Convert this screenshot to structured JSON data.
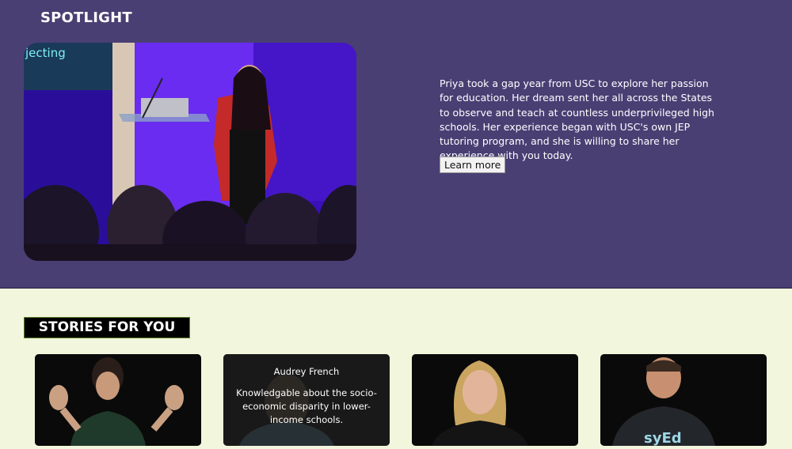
{
  "spotlight": {
    "title": "SPOTLIGHT",
    "screen_text": "jecting",
    "description": "Priya took a gap year from USC to explore her passion for education. Her dream sent her all across the States to observe and teach at countless underprivileged high schools. Her experience began with USC's own JEP tutoring program, and she is willing to share her experience with you today.",
    "button_label": "Learn more"
  },
  "stories": {
    "heading": "STORIES FOR YOU",
    "cards": [
      {
        "shirt_text": ""
      },
      {
        "name": "Audrey French",
        "description": "Knowledgable about the socio-economic disparity in lower-income schools."
      },
      {
        "shirt_text": ""
      },
      {
        "shirt_text": "syEd"
      }
    ]
  },
  "colors": {
    "spotlight_bg": "#493f73",
    "page_bg": "#f2f6dc",
    "stage_light": "#5a1ae6"
  }
}
